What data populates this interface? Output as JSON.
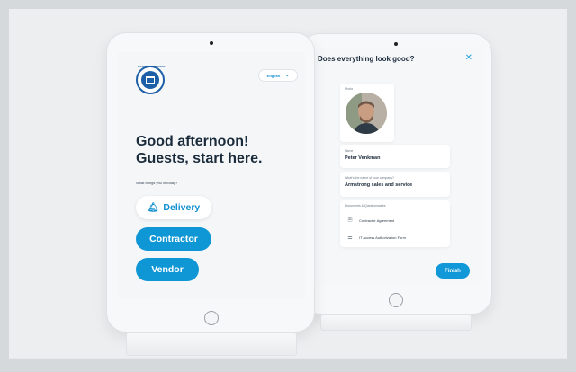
{
  "kiosk_welcome": {
    "language_selector": {
      "value": "English",
      "chevron_icon": "chevron-down-icon"
    },
    "logo": {
      "ring_text": "NORTH EDUCATION UNIVERSITY",
      "icon": "university-building-icon"
    },
    "greeting_line1": "Good afternoon!",
    "greeting_line2": "Guests, start here.",
    "question": "What brings you in today?",
    "options": [
      {
        "label": "Delivery",
        "icon": "bell-icon",
        "style": "outline"
      },
      {
        "label": "Contractor",
        "style": "filled"
      },
      {
        "label": "Vendor",
        "style": "filled"
      }
    ]
  },
  "review_screen": {
    "title": "Does everything look good?",
    "close_icon": "close-icon",
    "photo": {
      "label": "Photo"
    },
    "name": {
      "label": "Name",
      "value": "Peter Venkman"
    },
    "company": {
      "label": "What's the name of your company?",
      "value": "Armstrong sales and service"
    },
    "documents": {
      "label": "Documents & Questionnaires",
      "items": [
        {
          "label": "Contractor Agreement",
          "icon": "document-icon"
        },
        {
          "label": "IT Access Authorization Form",
          "icon": "checklist-icon"
        }
      ]
    },
    "finish_label": "Finish"
  },
  "colors": {
    "accent": "#0f96d5",
    "heading": "#1a2b3b",
    "background": "#eceef0"
  }
}
